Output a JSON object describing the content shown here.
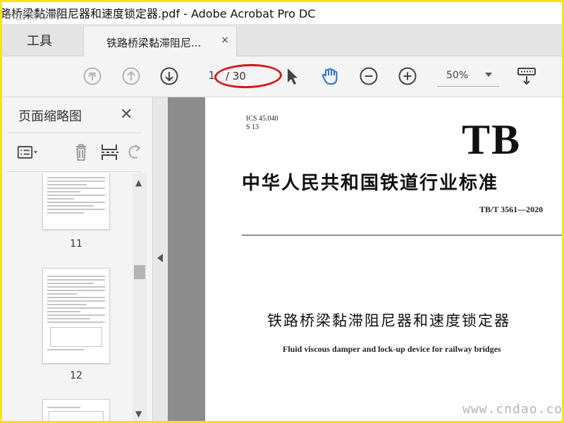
{
  "window": {
    "title": "路桥梁黏滞阻尼器和速度锁定器.pdf - Adobe Acrobat Pro DC",
    "watermark_top": "中国道标网",
    "watermark_bottom": "www.cndao.com"
  },
  "tabs": {
    "tools_label": "工具",
    "document_label": "铁路桥梁黏滞阻尼...",
    "close_glyph": "×"
  },
  "toolbar": {
    "current_page": "1",
    "page_total": "/ 30",
    "zoom": "50%",
    "icons": [
      "first-page-icon",
      "previous-page-icon",
      "next-page-icon",
      "select-cursor-icon",
      "hand-tool-icon",
      "zoom-out-icon",
      "zoom-in-icon",
      "keyboard-scroll-icon"
    ],
    "annotation_color": "#d6171b"
  },
  "thumbnail_panel": {
    "title": "页面缩略图",
    "close_glyph": "✕",
    "pages": [
      {
        "number": "11"
      },
      {
        "number": "12"
      },
      {
        "number": ""
      }
    ],
    "tool_icons": [
      "thumbnail-options-icon",
      "delete-page-icon",
      "extract-page-icon",
      "rotate-page-icon"
    ]
  },
  "document": {
    "ics": "ICS 45.040",
    "classification": "S 13",
    "logo": "TB",
    "standard_title": "中华人民共和国铁道行业标准",
    "standard_code": "TB/T 3561—2020",
    "title_cn": "铁路桥梁黏滞阻尼器和速度锁定器",
    "title_en": "Fluid viscous damper and lock-up device for railway bridges"
  },
  "colors": {
    "frame": "#f5e31a",
    "toolbar_bg": "#f4f4f4",
    "canvas_bg": "#8d8d8d",
    "hand_icon": "#2d6fd8"
  }
}
